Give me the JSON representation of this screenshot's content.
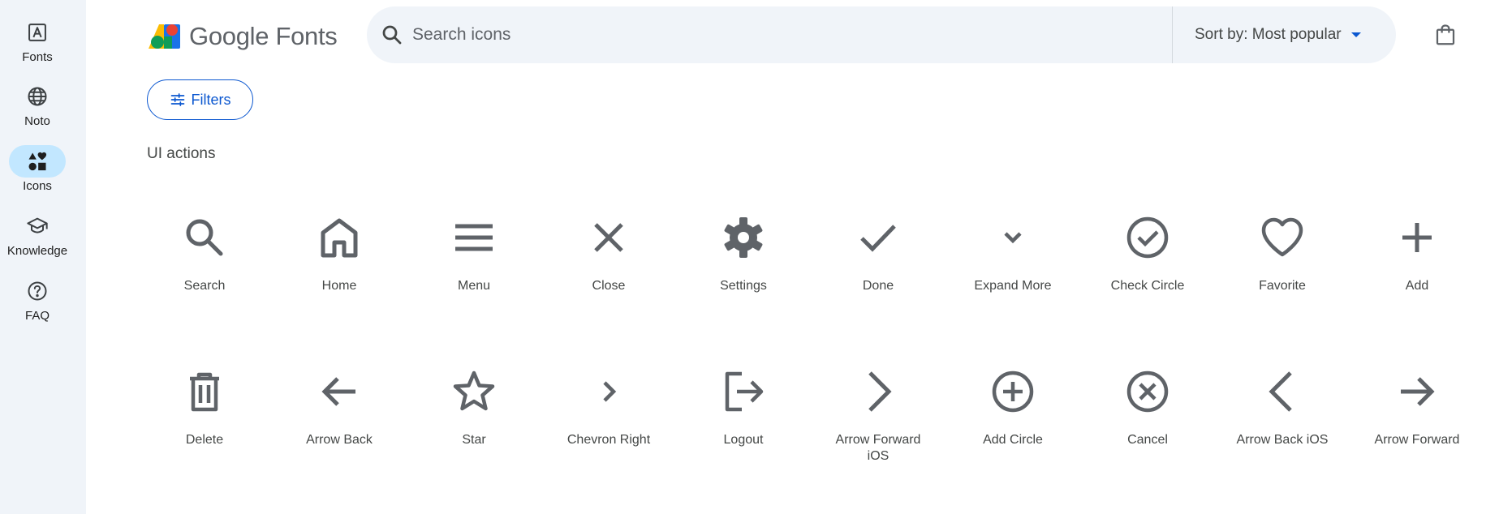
{
  "rail": {
    "items": [
      {
        "label": "Fonts",
        "icon": "font-icon",
        "active": false
      },
      {
        "label": "Noto",
        "icon": "globe-icon",
        "active": false
      },
      {
        "label": "Icons",
        "icon": "shapes-icon",
        "active": true
      },
      {
        "label": "Knowledge",
        "icon": "school-icon",
        "active": false
      },
      {
        "label": "FAQ",
        "icon": "help-icon",
        "active": false
      }
    ]
  },
  "header": {
    "logo_text": "Google Fonts",
    "search_placeholder": "Search icons",
    "sort_label": "Sort by: Most popular"
  },
  "filters_label": "Filters",
  "section_title": "UI actions",
  "icons": [
    {
      "label": "Search",
      "icon": "search-icon"
    },
    {
      "label": "Home",
      "icon": "home-icon"
    },
    {
      "label": "Menu",
      "icon": "menu-icon"
    },
    {
      "label": "Close",
      "icon": "close-icon"
    },
    {
      "label": "Settings",
      "icon": "settings-icon"
    },
    {
      "label": "Done",
      "icon": "done-icon"
    },
    {
      "label": "Expand More",
      "icon": "expand-more-icon"
    },
    {
      "label": "Check Circle",
      "icon": "check-circle-icon"
    },
    {
      "label": "Favorite",
      "icon": "favorite-icon"
    },
    {
      "label": "Add",
      "icon": "add-icon"
    },
    {
      "label": "Delete",
      "icon": "delete-icon"
    },
    {
      "label": "Arrow Back",
      "icon": "arrow-back-icon"
    },
    {
      "label": "Star",
      "icon": "star-icon"
    },
    {
      "label": "Chevron Right",
      "icon": "chevron-right-icon"
    },
    {
      "label": "Logout",
      "icon": "logout-icon"
    },
    {
      "label": "Arrow Forward iOS",
      "icon": "arrow-forward-ios-icon"
    },
    {
      "label": "Add Circle",
      "icon": "add-circle-icon"
    },
    {
      "label": "Cancel",
      "icon": "cancel-icon"
    },
    {
      "label": "Arrow Back iOS",
      "icon": "arrow-back-ios-icon"
    },
    {
      "label": "Arrow Forward",
      "icon": "arrow-forward-icon"
    }
  ],
  "colors": {
    "rail_bg": "#f0f4f9",
    "active_pill": "#c2e7ff",
    "accent": "#0b57d0",
    "icon": "#5f6368"
  }
}
